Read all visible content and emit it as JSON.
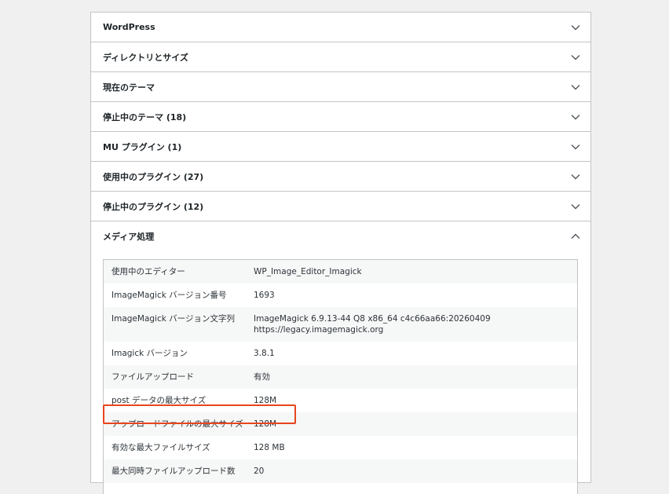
{
  "sections": [
    {
      "title": "WordPress",
      "open": false
    },
    {
      "title": "ディレクトリとサイズ",
      "open": false
    },
    {
      "title": "現在のテーマ",
      "open": false
    },
    {
      "title": "停止中のテーマ (18)",
      "open": false
    },
    {
      "title": "MU プラグイン (1)",
      "open": false
    },
    {
      "title": "使用中のプラグイン (27)",
      "open": false
    },
    {
      "title": "停止中のプラグイン (12)",
      "open": false
    },
    {
      "title": "メディア処理",
      "open": true
    }
  ],
  "media": {
    "rows": [
      {
        "key": "使用中のエディター",
        "value": "WP_Image_Editor_Imagick",
        "value2": ""
      },
      {
        "key": "ImageMagick バージョン番号",
        "value": "1693",
        "value2": ""
      },
      {
        "key": "ImageMagick バージョン文字列",
        "value": "ImageMagick 6.9.13-44 Q8 x86_64 c4c66aa66:20260409",
        "value2": "https://legacy.imagemagick.org"
      },
      {
        "key": "Imagick バージョン",
        "value": "3.8.1",
        "value2": ""
      },
      {
        "key": "ファイルアップロード",
        "value": "有効",
        "value2": ""
      },
      {
        "key": "post データの最大サイズ",
        "value": "128M",
        "value2": ""
      },
      {
        "key": "アップロードファイルの最大サイズ",
        "value": "128M",
        "value2": ""
      },
      {
        "key": "有効な最大ファイルサイズ",
        "value": "128 MB",
        "value2": ""
      },
      {
        "key": "最大同時ファイルアップロード数",
        "value": "20",
        "value2": ""
      }
    ]
  },
  "colors": {
    "highlight": "#e8451e",
    "border": "#c3c4c7",
    "stripe": "#f6f7f7"
  },
  "icons": {
    "collapsed": "chevron-down-icon",
    "expanded": "chevron-up-icon"
  }
}
